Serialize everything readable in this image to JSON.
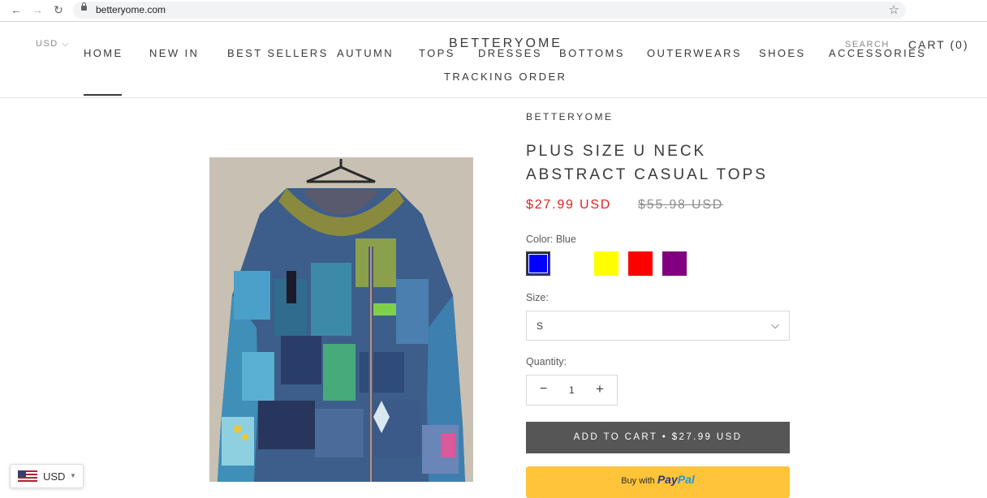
{
  "browser": {
    "url": "betteryome.com"
  },
  "header": {
    "currency": "USD",
    "logo": "BETTERYOME",
    "search": "SEARCH",
    "cart": "CART (0)",
    "nav": [
      "HOME",
      "NEW IN",
      "BEST SELLERS",
      "AUTUMN",
      "TOPS",
      "DRESSES",
      "BOTTOMS",
      "OUTERWEARS",
      "SHOES",
      "ACCESSORIES",
      "TRACKING ORDER"
    ]
  },
  "product": {
    "brand": "BETTERYOME",
    "title": "PLUS SIZE U NECK ABSTRACT CASUAL TOPS",
    "price_sale": "$27.99 USD",
    "price_compare": "$55.98 USD",
    "color_label": "Color: Blue",
    "swatches": [
      {
        "name": "blue",
        "color": "#0000ff",
        "selected": true
      },
      {
        "name": "white",
        "color": "#ffffff",
        "selected": false
      },
      {
        "name": "yellow",
        "color": "#ffff00",
        "selected": false
      },
      {
        "name": "red",
        "color": "#ff0000",
        "selected": false
      },
      {
        "name": "purple",
        "color": "#800080",
        "selected": false
      }
    ],
    "size_label": "Size:",
    "size_value": "S",
    "quantity_label": "Quantity:",
    "quantity": "1",
    "add_to_cart": "ADD TO CART  •  $27.99 USD",
    "paypal_prefix": "Buy with",
    "paypal_logo_1": "Pay",
    "paypal_logo_2": "Pal"
  },
  "currency_widget": {
    "label": "USD"
  },
  "colors": {
    "sale": "#e22120",
    "button": "#565656",
    "paypal": "#ffc439"
  }
}
